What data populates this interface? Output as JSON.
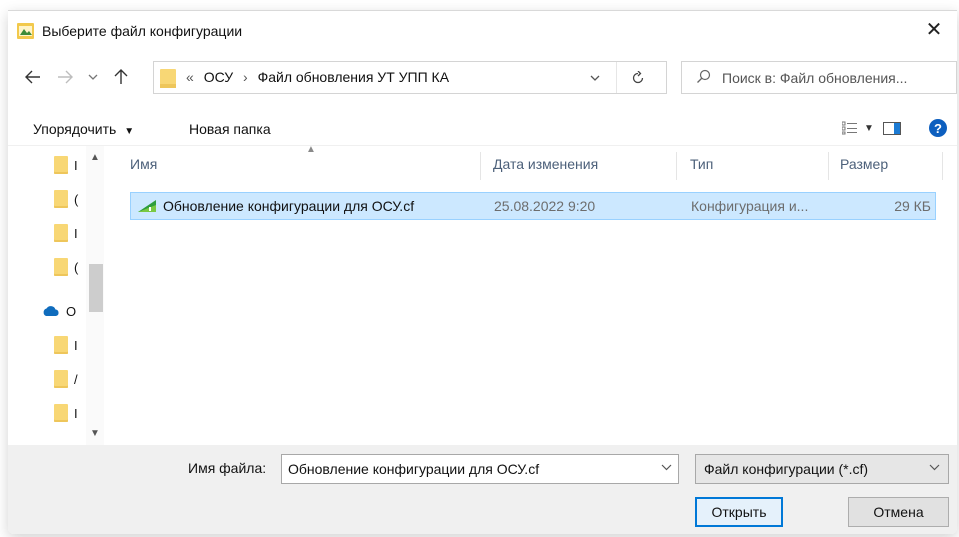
{
  "window": {
    "title": "Выберите файл конфигурации",
    "close_icon": "close-icon"
  },
  "nav": {
    "back_icon": "arrow-left-icon",
    "forward_icon": "arrow-right-icon",
    "recent_icon": "chevron-down-icon",
    "up_icon": "arrow-up-icon",
    "breadcrumb": {
      "overflow": "«",
      "part1": "ОСУ",
      "separator": "›",
      "part2": "Файл обновления УТ УПП КА"
    },
    "refresh_icon": "refresh-icon",
    "search_placeholder": "Поиск в: Файл обновления..."
  },
  "toolbar": {
    "organize_label": "Упорядочить",
    "new_folder_label": "Новая папка",
    "view_icon": "view-options-icon",
    "preview_icon": "preview-pane-icon",
    "help_label": "?"
  },
  "navpane": {
    "items": [
      {
        "type": "folder",
        "label": "I"
      },
      {
        "type": "folder",
        "label": "("
      },
      {
        "type": "folder",
        "label": "I"
      },
      {
        "type": "folder",
        "label": "("
      },
      {
        "type": "cloud",
        "label": "O"
      },
      {
        "type": "folder",
        "label": "I"
      },
      {
        "type": "folder",
        "label": "/"
      },
      {
        "type": "folder",
        "label": "I"
      }
    ]
  },
  "columns": {
    "name": "Имя",
    "date": "Дата изменения",
    "type": "Тип",
    "size": "Размер"
  },
  "files": [
    {
      "name": "Обновление конфигурации для ОСУ.cf",
      "date": "25.08.2022 9:20",
      "type": "Конфигурация и...",
      "size": "29 КБ"
    }
  ],
  "footer": {
    "filename_label": "Имя файла:",
    "filename_value": "Обновление конфигурации для ОСУ.cf",
    "filetype_value": "Файл конфигурации (*.cf)",
    "open_label": "Открыть",
    "cancel_label": "Отмена"
  },
  "colors": {
    "selection_bg": "#cce8ff",
    "selection_border": "#99d1ff",
    "accent": "#0078d7",
    "folder": "#f8d775"
  }
}
